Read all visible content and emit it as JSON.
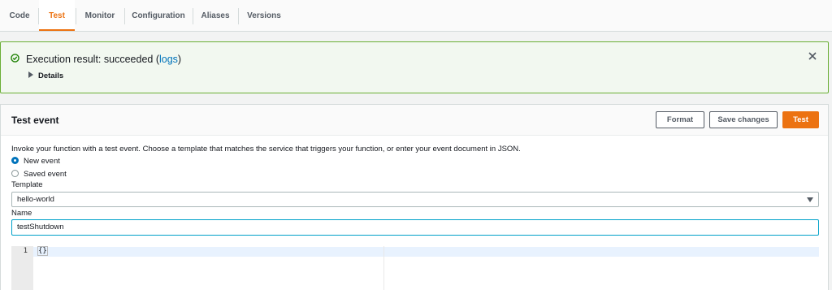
{
  "tabs": [
    "Code",
    "Test",
    "Monitor",
    "Configuration",
    "Aliases",
    "Versions"
  ],
  "active_tab": "Test",
  "alert": {
    "prefix": "Execution result: succeeded (",
    "link": "logs",
    "suffix": ")",
    "details": "Details",
    "status_color": "#1d8102"
  },
  "test_event": {
    "title": "Test event",
    "buttons": {
      "format": "Format",
      "save": "Save changes",
      "test": "Test"
    },
    "description": "Invoke your function with a test event. Choose a template that matches the service that triggers your function, or enter your event document in JSON.",
    "radios": [
      {
        "label": "New event",
        "selected": true
      },
      {
        "label": "Saved event",
        "selected": false
      }
    ],
    "template_label": "Template",
    "template_value": "hello-world",
    "name_label": "Name",
    "name_value": "testShutdown",
    "editor": {
      "line_number": "1",
      "code": "{}"
    }
  },
  "colors": {
    "accent": "#ec7211",
    "link": "#0073bb",
    "success_border": "#6aaf35"
  },
  "icons": [
    "check-circle-icon",
    "caret-right-icon",
    "close-icon",
    "dropdown-caret-icon"
  ]
}
